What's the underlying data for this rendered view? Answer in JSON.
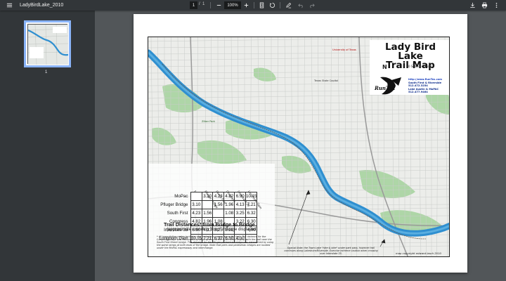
{
  "toolbar": {
    "title": "LadyBirdLake_2010",
    "current_page": "1",
    "page_separator": "/",
    "total_pages": "1",
    "zoom": "100%"
  },
  "sidebar": {
    "thumbnail_label": "1"
  },
  "map": {
    "title_line1": "Lady Bird Lake",
    "title_line2": "Trail Map",
    "north": "N",
    "scale": "0    Scale - miles    0.5",
    "runtex_url": "http://www.RunTex.com",
    "runtex_lines": [
      "South First & Riverside",
      "512.472.3254",
      "Lake Austin & MoPAC",
      "512.477.9464"
    ],
    "labels": {
      "university": "University of Texas",
      "capitol": "Texas State Capitol",
      "zilker": "Zilker Park"
    },
    "table": {
      "columns": [
        "MoPac",
        "Pfluger Bridge",
        "South First",
        "Congress",
        "Interstate 35",
        "Longhorn Dam"
      ],
      "rows": [
        {
          "label": "MoPac",
          "values": [
            "",
            "3.10",
            "4.23",
            "4.82",
            "6.90",
            "10.15"
          ]
        },
        {
          "label": "Pfluger Bridge",
          "values": [
            "3.10",
            "",
            "1.56",
            "1.96",
            "4.13",
            "7.21"
          ]
        },
        {
          "label": "South First",
          "values": [
            "4.23",
            "1.56",
            "",
            "1.08",
            "3.25",
            "6.32"
          ]
        },
        {
          "label": "Congress",
          "values": [
            "4.82",
            "1.96",
            "1.08",
            "",
            "3.22",
            "6.30"
          ]
        },
        {
          "label": "Interstate 35",
          "values": [
            "6.90",
            "4.13",
            "3.25",
            "3.22",
            "",
            "4.00"
          ]
        },
        {
          "label": "Longhorn Dam",
          "values": [
            "10.15",
            "7.21",
            "6.32",
            "6.30",
            "4.00",
            ""
          ]
        }
      ]
    },
    "table_title": "Trail Distances* from Bridge to Bridge",
    "table_subtitle": "(approximate roundtrip \"loop\" mileage displayed)",
    "footnote": "* All loops follow routes including the pedestrian ramps along the trail. The distance for the Congress bridge was calculated by looping around the Hyatt and merging with the trail near the South First Street bridge. The distance for the Pfluger pedestrian bridge was determined by using the spiral ramps at both ends of the bridge. Note that piers and pedestrian bridges are located under the MoPAC expressway and interchange.",
    "special_note": "Special Note: the Town Lake \"hike & bike\" under park pass, however trail continues along Lakeshore/Riverside. Exercise extreme caution when crossing over Interstate 35.",
    "copyright": "map copyright edward lasch 2010"
  },
  "colors": {
    "toolbar_bg": "#323639",
    "viewer_bg": "#525659",
    "water": "#2f8fd0",
    "park": "#a8d4a0",
    "accent": "#8ab4f8"
  }
}
